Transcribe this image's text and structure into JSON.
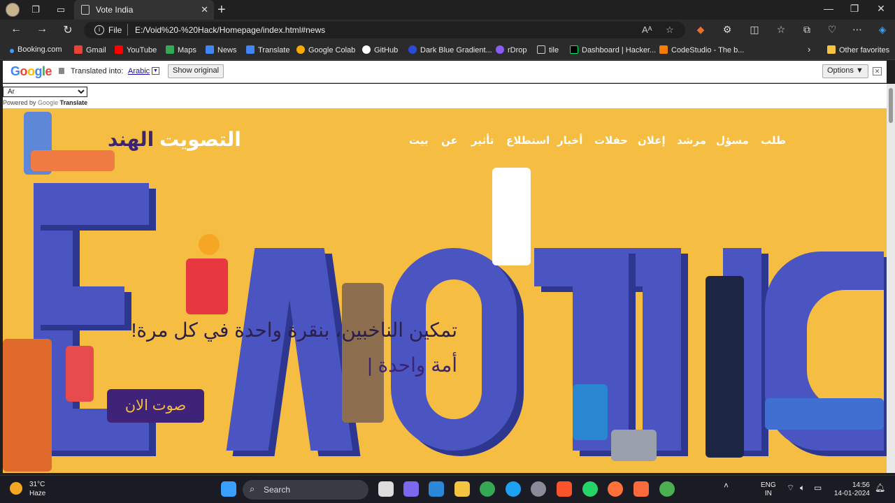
{
  "browser": {
    "tab_title": "Vote India",
    "scheme": "File",
    "url": "E:/Void%20-%20Hack/Homepage/index.html#news"
  },
  "bookmarks": [
    {
      "label": "Booking.com",
      "color": "#003580"
    },
    {
      "label": "Gmail",
      "color": "#ea4335"
    },
    {
      "label": "YouTube",
      "color": "#ff0000"
    },
    {
      "label": "Maps",
      "color": "#34a853"
    },
    {
      "label": "News",
      "color": "#4285f4"
    },
    {
      "label": "Translate",
      "color": "#4285f4"
    },
    {
      "label": "Google Colab",
      "color": "#f9ab00"
    },
    {
      "label": "GitHub",
      "color": "#ffffff"
    },
    {
      "label": "Dark Blue Gradient...",
      "color": "#2a4bd7"
    },
    {
      "label": "rDrop",
      "color": "#8a5cf6"
    },
    {
      "label": "tile",
      "color": "#cccccc"
    },
    {
      "label": "Dashboard | Hacker...",
      "color": "#00ea64"
    },
    {
      "label": "CodeStudio - The b...",
      "color": "#f57c00"
    }
  ],
  "bookmarks_other": "Other favorites",
  "translate": {
    "logo": "Google",
    "label": "Translated into:",
    "language": "Arabic",
    "show_original": "Show original",
    "options": "Options ▼",
    "select_value": "Ar",
    "powered_by": "Powered by",
    "powered_google": "Google",
    "powered_translate": "Translate"
  },
  "site": {
    "brand_part1": "التصويت",
    "brand_part2": "الهند",
    "nav": [
      "طلب",
      "مسؤل",
      "مرشد",
      "إعلان",
      "حفلات",
      "أخبار",
      "استطلاع",
      "تأثير",
      "عن",
      "بيت"
    ],
    "hero_line1": "تمكين الناخبين، بنقرة واحدة في كل مرة!",
    "hero_line2": "أمة واحدة |",
    "vote_button": "صوت الان",
    "accent_bg": "#f5bd41",
    "accent_purple": "#3e2378",
    "letter_blue": "#4b55c2"
  },
  "taskbar": {
    "temp": "31°C",
    "weather": "Haze",
    "search": "Search",
    "lang1": "ENG",
    "lang2": "IN",
    "time": "14:56",
    "date": "14-01-2024"
  }
}
